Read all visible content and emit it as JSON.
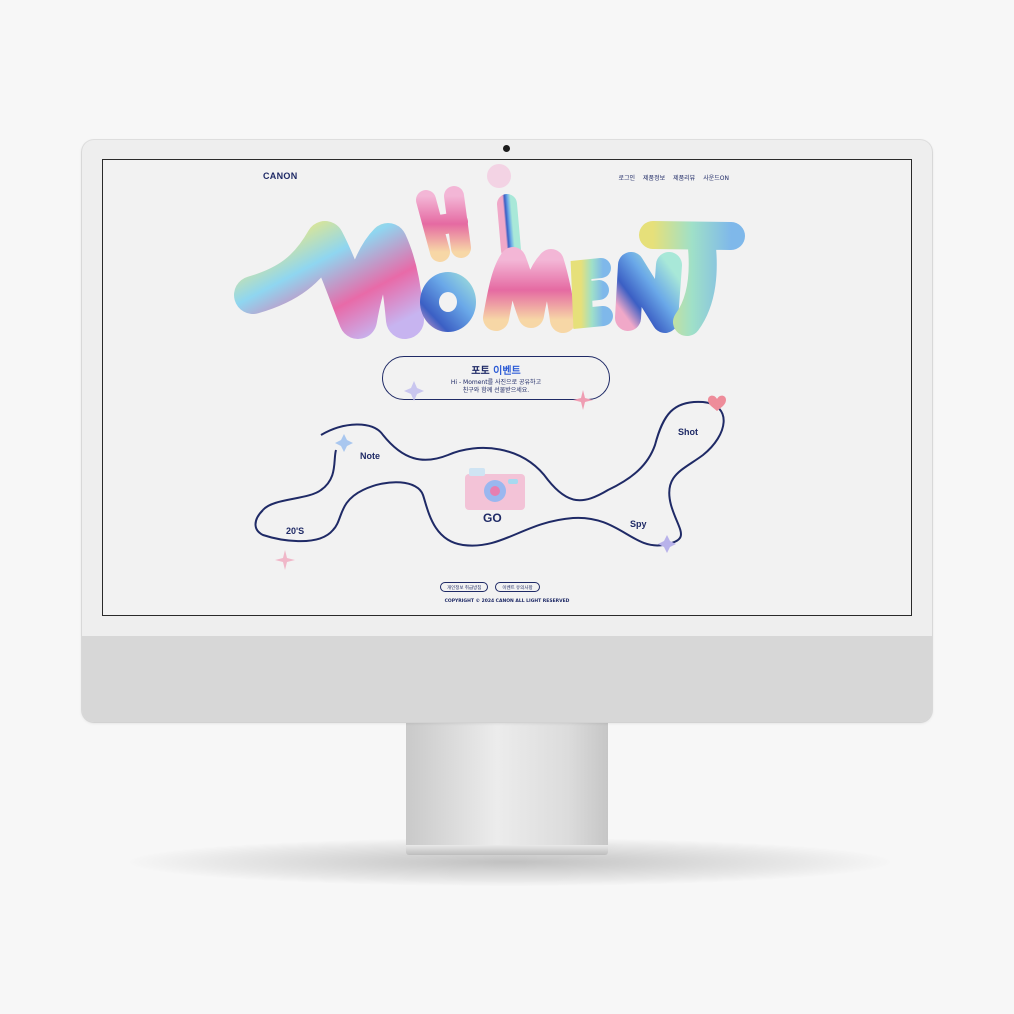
{
  "header": {
    "brand": "CANON",
    "nav": [
      "로그인",
      "제품정보",
      "제품리뷰",
      "사운드ON"
    ]
  },
  "hero": {
    "line1": "Hi",
    "line2": "MOMENT"
  },
  "event": {
    "title_prefix": "포토",
    "title_highlight": "이벤트",
    "desc_line1": "Hi - Moment를 사진으로 공유하고",
    "desc_line2": "친구와 함께 선물받으세요."
  },
  "path_stops": {
    "note": "Note",
    "shot": "Shot",
    "twenties": "20'S",
    "spy": "Spy",
    "go": "GO"
  },
  "footer": {
    "privacy_button": "개인정보 취급방침",
    "notice_button": "이벤트 유의사항",
    "copyright": "COPYRIGHT © 2024 CANON ALL LIGHT RESERVED"
  },
  "colors": {
    "navy": "#1f2a66",
    "accent": "#2d5cd6"
  },
  "icons": [
    "camera-icon",
    "sparkle-icon",
    "heart-icon"
  ]
}
